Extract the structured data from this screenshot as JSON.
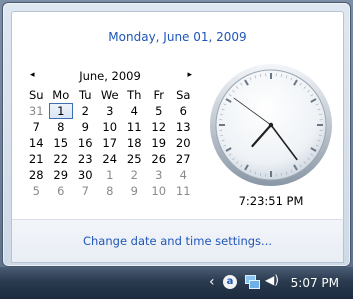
{
  "header": {
    "date_text": "Monday, June 01, 2009"
  },
  "calendar": {
    "month_label": "June, 2009",
    "prev_arrow": "◂",
    "next_arrow": "▸",
    "weekdays": [
      "Su",
      "Mo",
      "Tu",
      "We",
      "Th",
      "Fr",
      "Sa"
    ],
    "weeks": [
      [
        {
          "d": "31",
          "o": true
        },
        {
          "d": "1",
          "s": true
        },
        {
          "d": "2"
        },
        {
          "d": "3"
        },
        {
          "d": "4"
        },
        {
          "d": "5"
        },
        {
          "d": "6"
        }
      ],
      [
        {
          "d": "7"
        },
        {
          "d": "8"
        },
        {
          "d": "9"
        },
        {
          "d": "10"
        },
        {
          "d": "11"
        },
        {
          "d": "12"
        },
        {
          "d": "13"
        }
      ],
      [
        {
          "d": "14"
        },
        {
          "d": "15"
        },
        {
          "d": "16"
        },
        {
          "d": "17"
        },
        {
          "d": "18"
        },
        {
          "d": "19"
        },
        {
          "d": "20"
        }
      ],
      [
        {
          "d": "21"
        },
        {
          "d": "22"
        },
        {
          "d": "23"
        },
        {
          "d": "24"
        },
        {
          "d": "25"
        },
        {
          "d": "26"
        },
        {
          "d": "27"
        }
      ],
      [
        {
          "d": "28"
        },
        {
          "d": "29"
        },
        {
          "d": "30"
        },
        {
          "d": "1",
          "o": true
        },
        {
          "d": "2",
          "o": true
        },
        {
          "d": "3",
          "o": true
        },
        {
          "d": "4",
          "o": true
        }
      ],
      [
        {
          "d": "5",
          "o": true
        },
        {
          "d": "6",
          "o": true
        },
        {
          "d": "7",
          "o": true
        },
        {
          "d": "8",
          "o": true
        },
        {
          "d": "9",
          "o": true
        },
        {
          "d": "10",
          "o": true
        },
        {
          "d": "11",
          "o": true
        }
      ]
    ]
  },
  "clock": {
    "time_text": "7:23:51 PM",
    "hours": 7,
    "minutes": 23,
    "seconds": 51
  },
  "footer": {
    "change_link": "Change date and time settings..."
  },
  "taskbar": {
    "tray_icons": [
      "chevron-left-icon",
      "antivirus-icon",
      "network-icon",
      "volume-icon"
    ],
    "clock": "5:07 PM"
  },
  "colors": {
    "link": "#1f56b8",
    "selected_outline": "#3f6fb3"
  }
}
